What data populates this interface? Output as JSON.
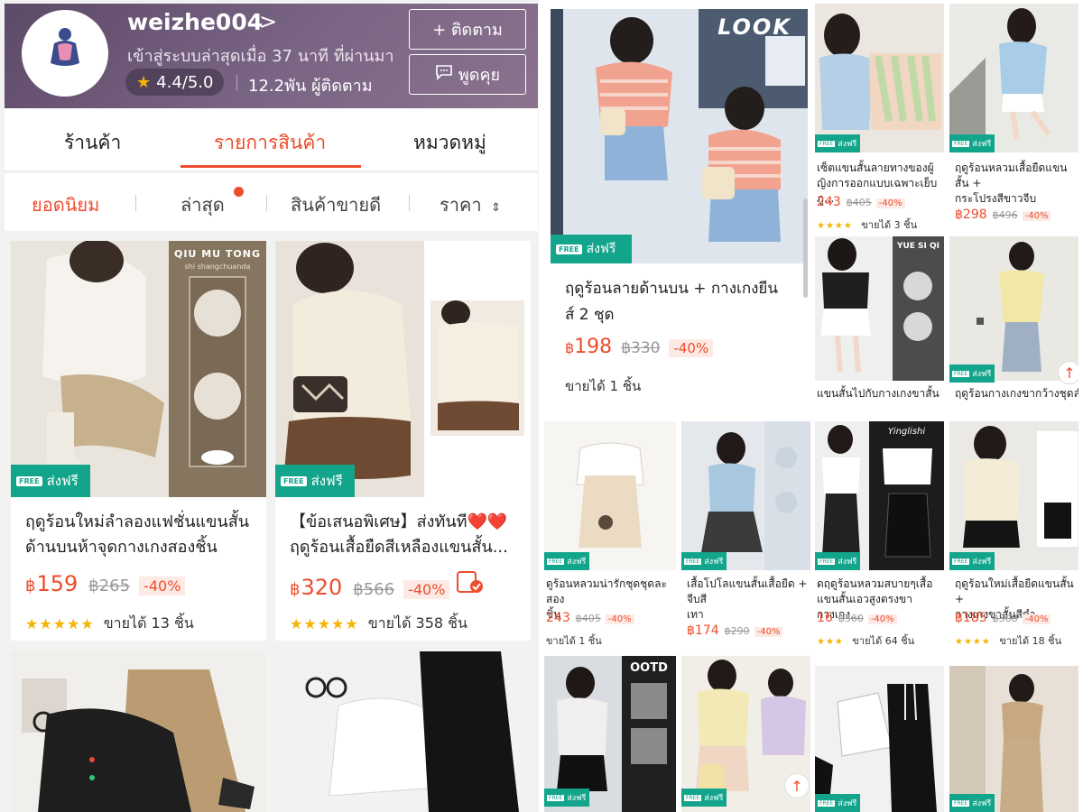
{
  "shop": {
    "name": "weizhe004",
    "name_arrow": ">",
    "last_seen": "เข้าสู่ระบบล่าสุดเมื่อ 37 นาที ที่ผ่านมา",
    "rating": "4.4/5.0",
    "followers": "12.2พัน ผู้ติดตาม",
    "follow_button": "+ ติดตาม",
    "chat_button": "พูดคุย",
    "logo_text": "Fashion"
  },
  "tabs": [
    "ร้านค้า",
    "รายการสินค้า",
    "หมวดหมู่"
  ],
  "sort": {
    "popular": "ยอดนิยม",
    "latest": "ล่าสุด",
    "bestseller": "สินค้าขายดี",
    "price": "ราคา",
    "price_icon": "⌃⌄"
  },
  "badges": {
    "free": "FREE",
    "ship": "ส่งฟรี"
  },
  "colors": {
    "accent": "#ee4d2d",
    "ship_green": "#12a58c",
    "header_purple": "#6b5677"
  },
  "left_products": [
    {
      "title_line1": "ฤดูร้อนใหม่ลำลองแฟชั่นแขนสั้น",
      "title_line2": "ด้านบนห้าจุดกางเกงสองชิ้น",
      "image_text": "QIU MU TONG",
      "image_subtext": "shi shangchuanda",
      "currency": "฿",
      "price": "159",
      "original": "฿265",
      "discount": "-40%",
      "stars": "★★★★★",
      "sold": "ขายได้ 13 ชิ้น"
    },
    {
      "title_line1": "【ข้อเสนอพิเศษ】ส่งทันที❤️❤️",
      "title_line2": "ฤดูร้อนเสื้อยืดสีเหลืองแขนสั้น...",
      "currency": "฿",
      "price": "320",
      "original": "฿566",
      "discount": "-40%",
      "stars": "★★★★★",
      "sold": "ขายได้ 358 ชิ้น"
    }
  ],
  "featured": {
    "image_text": "LOOK",
    "title_line1": "ฤดูร้อนลายด้านบน + กางเกงยีน",
    "title_line2": "ส์ 2 ชุด",
    "currency": "฿",
    "price": "198",
    "original": "฿330",
    "discount": "-40%",
    "sold": "ขายได้ 1 ชิ้น"
  },
  "right_top": [
    {
      "title_line1": "เซ็ตแขนสั้นลายทางของผู้",
      "title_line2": "ญิงการออกแบบเฉพาะเย็บภู...",
      "price": "243",
      "original": "฿405",
      "discount": "-40%",
      "stars": "★★★★",
      "sold": "ขายได้ 3 ชิ้น"
    },
    {
      "title_line1": "ฤดูร้อนหลวมเสื้อยืดแขนสั้น +",
      "title_line2": "กระโปรงสีขาวจีบ",
      "price": "฿298",
      "original": "฿496",
      "discount": "-40%"
    },
    {
      "title_line1": "แขนสั้นไปกับกางเกงขาสั้น",
      "image_text": "YUE SI QI"
    },
    {
      "title_line1": "ฤดูร้อนกางเกงขากว้างชุดลำลอง"
    }
  ],
  "right_bottom": [
    {
      "title_line1": "ดูร้อนหลวมน่ารักชุดชุดละสอง",
      "title_line2": "ชิ้น",
      "price": "243",
      "original": "฿405",
      "discount": "-40%",
      "sold": "ขายได้ 1 ชิ้น"
    },
    {
      "title_line1": "เสื้อโปโลแขนสั้นเสื้อยืด + จีบสี",
      "title_line2": "เทา",
      "price": "฿174",
      "original": "฿290",
      "discount": "-40%"
    },
    {
      "title_line1": "ดฤดูร้อนหลวมสบายๆเสื้อ",
      "title_line2": "แขนสั้นเอวสูงตรงขากางเกง...",
      "price": "16",
      "original": "฿360",
      "discount": "-40%",
      "stars": "★★★",
      "sold": "ขายได้ 64 ชิ้น",
      "image_text": "Yinglishi"
    },
    {
      "title_line1": "ฤดูร้อนใหม่เสื้อยืดแขนสั้น +",
      "title_line2": "กางเกงขาสั้นสีดำ",
      "price": "฿185",
      "original": "฿308",
      "discount": "-40%",
      "stars": "★★★★",
      "sold": "ขายได้ 18 ชิ้น"
    }
  ],
  "bottom_row": [
    {
      "image_text": "OOTD"
    }
  ]
}
